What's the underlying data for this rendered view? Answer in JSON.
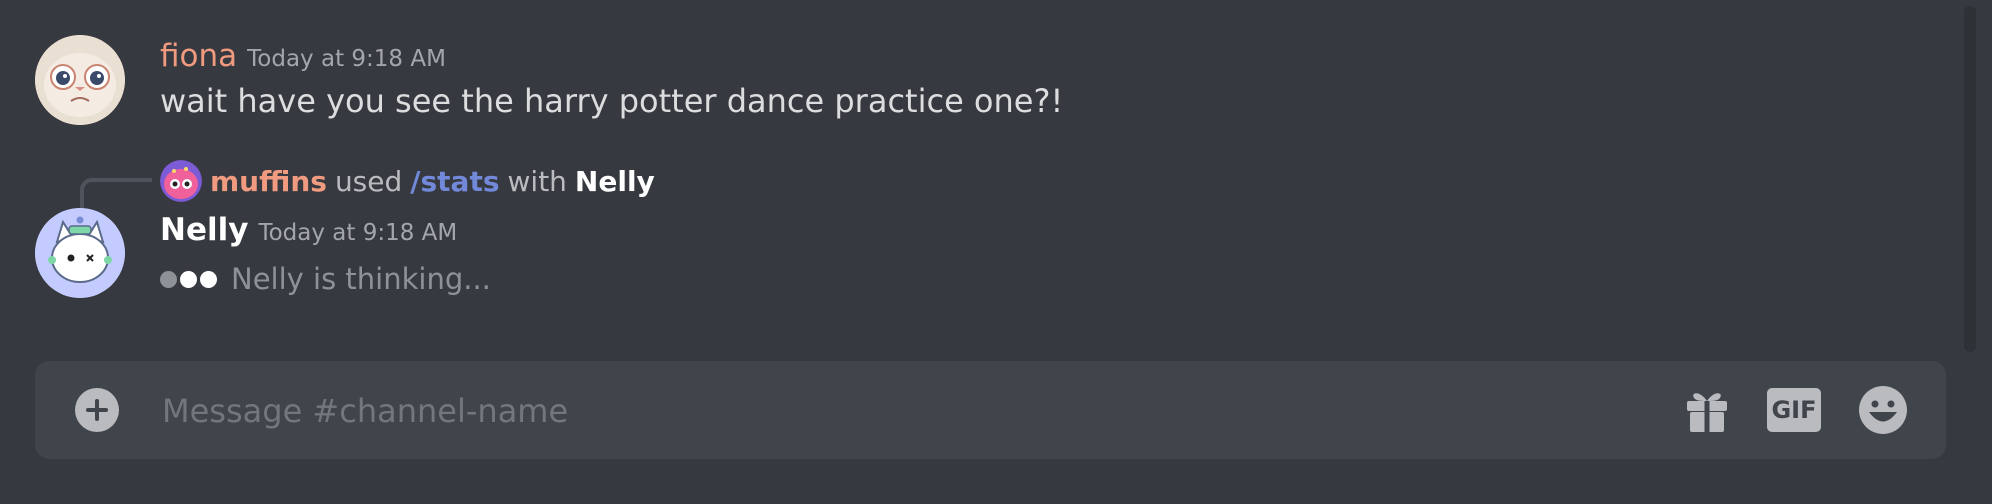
{
  "messages": [
    {
      "author": "fiona",
      "timestamp": "Today at 9:18 AM",
      "content": "wait have you see the harry potter dance practice one?!",
      "author_color": "#f09b80",
      "avatar_icon": "cat-face-avatar"
    },
    {
      "author": "Nelly",
      "timestamp": "Today at 9:18 AM",
      "status": "Nelly is thinking...",
      "author_color": "#ffffff",
      "avatar_icon": "robot-cat-avatar",
      "interaction": {
        "user": "muffins",
        "verb": "used",
        "command": "/stats",
        "preposition": "with",
        "target": "Nelly",
        "user_color": "#f09b80",
        "command_color": "#7289da",
        "avatar_icon": "octopus-avatar"
      }
    }
  ],
  "composer": {
    "placeholder": "Message #channel-name",
    "value": "",
    "gif_label": "GIF",
    "icons": [
      "plus-circle-icon",
      "gift-icon",
      "gif-icon",
      "emoji-icon"
    ]
  },
  "theme": {
    "background": "#36393f",
    "input_background": "#40444b",
    "muted_text": "#72767d"
  }
}
